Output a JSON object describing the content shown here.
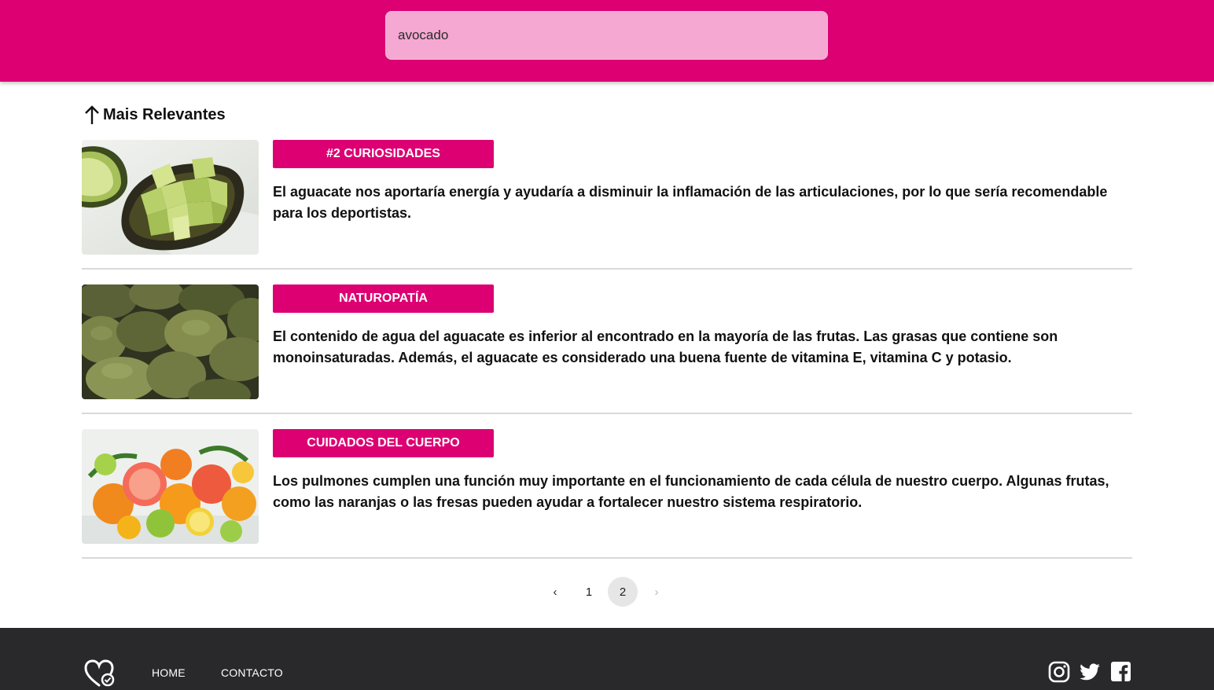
{
  "header": {
    "search_value": "avocado"
  },
  "sort": {
    "label": "Mais Relevantes",
    "icon": "arrow-up-icon"
  },
  "articles": [
    {
      "category": "#2 Curiosidades",
      "summary": "El aguacate nos aportaría energía y ayudaría a disminuir la inflamación de las articulaciones, por lo que sería recomendable para los deportistas.",
      "image": "avocado-halved-image"
    },
    {
      "category": "Naturopatía",
      "summary_parts": [
        "El contenido de agua del aguacate es inferior al encontrado en la mayoría de las frutas. Las grasas que contiene son monoinsaturadas. Además, el aguacate es considerado una buena fuente de vitamina ",
        "E",
        ", vitamina ",
        "C",
        " y potasio."
      ],
      "image": "avocados-pile-image"
    },
    {
      "category": "Cuidados del cuerpo",
      "summary": "Los pulmones cumplen una función muy importante en el funcionamiento de cada célula de nuestro cuerpo. Algunas frutas, como las naranjas o las fresas pueden ayudar a fortalecer nuestro sistema respiratorio.",
      "image": "citrus-fruits-image"
    }
  ],
  "pagination": {
    "prev": "‹",
    "pages": [
      "1",
      "2"
    ],
    "current": "2",
    "next": "›"
  },
  "footer": {
    "nav": [
      "Home",
      "Contacto"
    ],
    "social": [
      "instagram-icon",
      "twitter-icon",
      "facebook-icon"
    ]
  },
  "colors": {
    "brand": "#dc0073",
    "search_bg": "#f4a8d2",
    "footer_bg": "#29292b"
  }
}
